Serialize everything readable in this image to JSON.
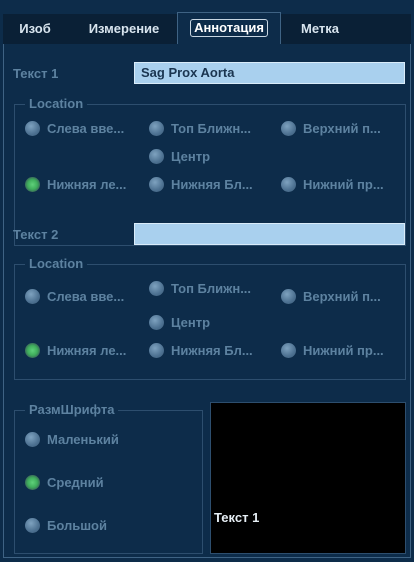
{
  "tabs": [
    {
      "label": "Изоб"
    },
    {
      "label": "Измерение"
    },
    {
      "label": "Аннотация"
    },
    {
      "label": "Метка"
    }
  ],
  "text1": {
    "label": "Текст 1",
    "value": "Sag Prox Aorta"
  },
  "text2": {
    "label": "Текст 2",
    "value": ""
  },
  "location_legend": "Location",
  "location1": {
    "options": [
      {
        "label": "Слева вве..."
      },
      {
        "label": "Топ Ближн..."
      },
      {
        "label": "Верхний п..."
      },
      {
        "label": "Центр"
      },
      {
        "label": "Нижняя ле..."
      },
      {
        "label": "Нижняя Бл..."
      },
      {
        "label": "Нижний пр..."
      }
    ],
    "selected": "Нижняя ле..."
  },
  "location2": {
    "options": [
      {
        "label": "Слева вве..."
      },
      {
        "label": "Топ Ближн..."
      },
      {
        "label": "Верхний п..."
      },
      {
        "label": "Центр"
      },
      {
        "label": "Нижняя ле..."
      },
      {
        "label": "Нижняя Бл..."
      },
      {
        "label": "Нижний пр..."
      }
    ],
    "selected": "Нижняя ле..."
  },
  "font_size": {
    "legend": "РазмШрифта",
    "options": [
      {
        "label": "Маленький"
      },
      {
        "label": "Средний"
      },
      {
        "label": "Большой"
      }
    ],
    "selected": "Средний"
  },
  "preview": {
    "text": "Текст 1"
  },
  "colors": {
    "selected_dot": "#3fae5c",
    "field_bg": "#a9d0ee",
    "panel_bg": "#0d2c4a"
  }
}
